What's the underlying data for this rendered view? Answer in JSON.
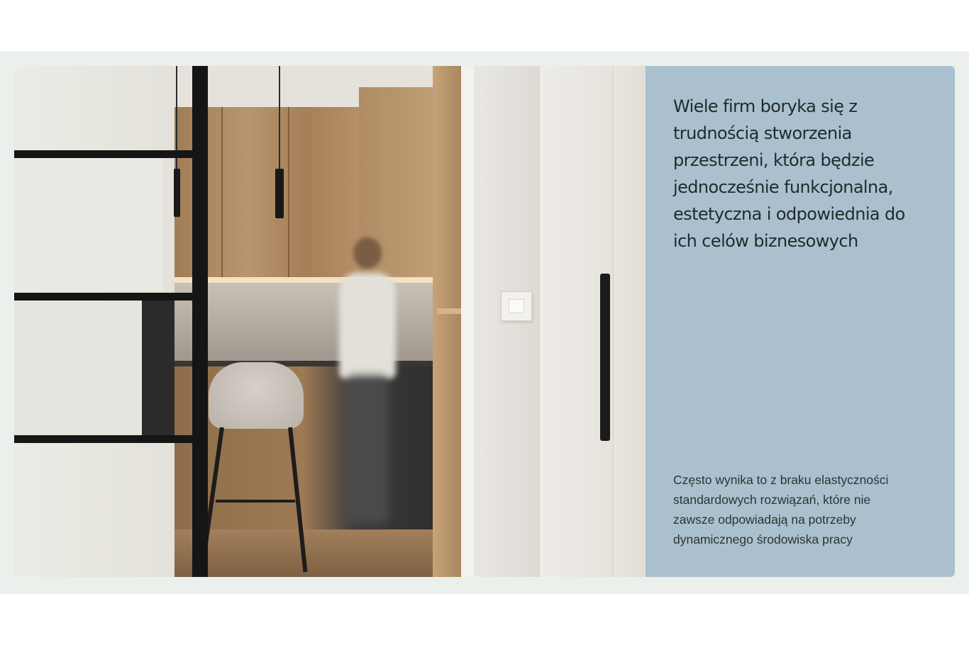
{
  "section": {
    "headline": "Wiele firm boryka się z trudnością stworzenia przestrzeni, która będzie jednocześnie funkcjonalna, estetyczna i odpowiednia do ich celów biznesowych",
    "body": "Często wynika to z braku elastyczności standardowych rozwiązań, które nie zawsze odpowiadają na potrzeby dynamicznego środowiska pracy"
  },
  "colors": {
    "page_background": "#ffffff",
    "band_background": "#ebf0ec",
    "panel_background": "#abc0cf",
    "headline_text": "#1f2b2b",
    "body_text": "#2b3434"
  }
}
